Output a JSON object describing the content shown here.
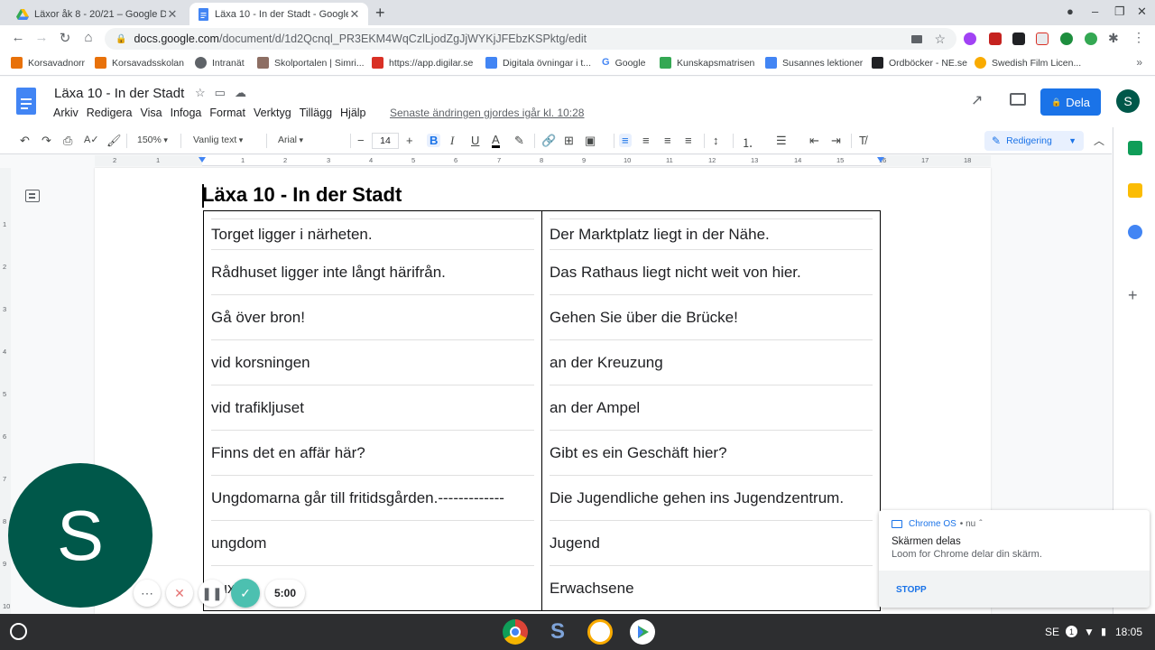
{
  "browser": {
    "tabs": [
      {
        "title": "Läxor åk 8 - 20/21 – Google Drive",
        "active": false
      },
      {
        "title": "Läxa 10 - In der Stadt - Google Docs",
        "active": true
      }
    ],
    "url": {
      "host": "docs.google.com",
      "path": "/document/d/1d2Qcnql_PR3EKM4WqCzlLjodZgJjWYKjJFEbzKSPktg/edit"
    },
    "bookmarks": [
      {
        "label": "Korsavadnorr",
        "color": "#e8710a"
      },
      {
        "label": "Korsavadsskolan",
        "color": "#e8710a"
      },
      {
        "label": "Intranät",
        "color": "#5f6368"
      },
      {
        "label": "Skolportalen | Simri...",
        "color": "#8d6e63"
      },
      {
        "label": "https://app.digilar.se",
        "color": "#d93025"
      },
      {
        "label": "Digitala övningar i t...",
        "color": "#4285f4"
      },
      {
        "label": "Google",
        "color": "#4285f4"
      },
      {
        "label": "Kunskapsmatrisen",
        "color": "#34a853"
      },
      {
        "label": "Susannes lektioner",
        "color": "#4285f4"
      },
      {
        "label": "Ordböcker - NE.se",
        "color": "#202124"
      },
      {
        "label": "Swedish Film Licen...",
        "color": "#f9ab00"
      }
    ]
  },
  "docs": {
    "title": "Läxa 10 - In der Stadt",
    "menu": [
      "Arkiv",
      "Redigera",
      "Visa",
      "Infoga",
      "Format",
      "Verktyg",
      "Tillägg",
      "Hjälp"
    ],
    "last_edit": "Senaste ändringen gjordes igår kl. 10:28",
    "share_label": "Dela",
    "avatar_letter": "S",
    "toolbar": {
      "zoom": "150%",
      "style": "Vanlig text",
      "font": "Arial",
      "font_size": "14",
      "mode": "Redigering"
    }
  },
  "document": {
    "heading": "Läxa 10 - In der Stadt",
    "rows": [
      {
        "sv": "Torget ligger i närheten.",
        "de": "Der Marktplatz liegt in der Nähe."
      },
      {
        "sv": "Rådhuset ligger inte långt härifrån.",
        "de": "Das Rathaus liegt nicht weit von hier."
      },
      {
        "sv": "Gå över bron!",
        "de": "Gehen Sie über die Brücke!"
      },
      {
        "sv": "vid korsningen",
        "de": "an der Kreuzung"
      },
      {
        "sv": "vid trafikljuset",
        "de": "an der Ampel"
      },
      {
        "sv": "Finns det en affär här?",
        "de": "Gibt es ein Geschäft hier?"
      },
      {
        "sv": "Ungdomarna går till fritidsgården.-------------",
        "de": "Die Jugendliche gehen ins Jugendzentrum."
      },
      {
        "sv": "ungdom",
        "de": "Jugend"
      },
      {
        "sv": "vuxna",
        "de": "Erwachsene"
      }
    ]
  },
  "ruler": {
    "ticks": [
      "2",
      "1",
      "1",
      "2",
      "3",
      "4",
      "5",
      "6",
      "7",
      "8",
      "9",
      "10",
      "11",
      "12",
      "13",
      "14",
      "15",
      "16",
      "17",
      "18"
    ],
    "vticks": [
      "1",
      "2",
      "3",
      "4",
      "5",
      "6",
      "7",
      "8",
      "9",
      "10"
    ]
  },
  "loom": {
    "avatar_letter": "S",
    "timer": "5:00"
  },
  "notification": {
    "source": "Chrome OS",
    "time": "• nu",
    "title": "Skärmen delas",
    "body": "Loom for Chrome delar din skärm.",
    "action": "STOPP"
  },
  "shelf": {
    "locale": "SE",
    "badge": "1",
    "clock": "18:05"
  }
}
